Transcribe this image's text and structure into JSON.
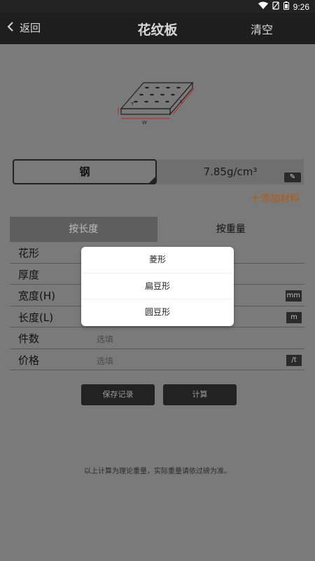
{
  "status": {
    "time": "9:26",
    "icons": [
      "wifi-icon",
      "no-sim-icon",
      "battery-icon"
    ]
  },
  "nav": {
    "back_label": "返回",
    "title": "花纹板",
    "clear_label": "清空"
  },
  "diagram": {
    "labels": [
      "T",
      "W",
      "L"
    ]
  },
  "material": {
    "name": "钢",
    "density": "7.85g/cm³"
  },
  "add_material_label": "十添加材料",
  "tabs": [
    {
      "label": "按长度",
      "active": false
    },
    {
      "label": "按重量",
      "active": true
    }
  ],
  "form": {
    "rows": [
      {
        "label": "花形",
        "placeholder": "",
        "unit": ""
      },
      {
        "label": "厚度",
        "placeholder": "",
        "unit": ""
      },
      {
        "label": "宽度(H)",
        "placeholder": "",
        "unit": "mm"
      },
      {
        "label": "长度(L)",
        "placeholder": "",
        "unit": "m"
      },
      {
        "label": "件数",
        "placeholder": "选填",
        "unit": ""
      },
      {
        "label": "价格",
        "placeholder": "选填",
        "unit": "/t"
      }
    ]
  },
  "buttons": {
    "save_label": "保存记录",
    "calc_label": "计算"
  },
  "note": "以上计算为理论重量，实际重量请依过磅为准。",
  "popup": {
    "options": [
      "菱形",
      "扁豆形",
      "圆豆形"
    ]
  },
  "colors": {
    "accent": "#b35a10",
    "navbar": "#1e1e1e",
    "overlay": "#7a7a7a"
  }
}
